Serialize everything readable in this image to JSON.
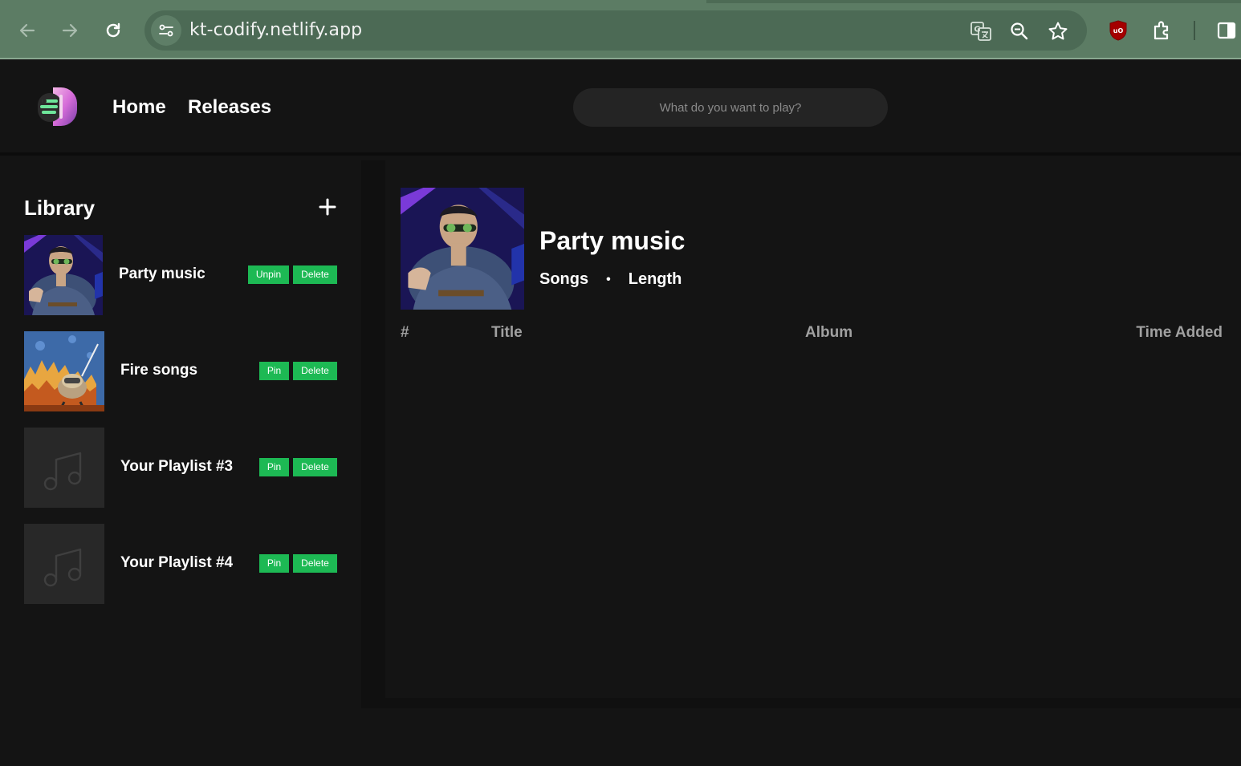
{
  "browser": {
    "url": "kt-codify.netlify.app",
    "icons": [
      "back-arrow-icon",
      "forward-arrow-icon",
      "reload-icon",
      "site-settings-icon",
      "translate-icon",
      "zoom-icon",
      "star-icon",
      "ublock-icon",
      "extensions-icon",
      "side-panel-icon"
    ]
  },
  "header": {
    "nav": [
      "Home",
      "Releases"
    ],
    "search_placeholder": "What do you want to play?"
  },
  "sidebar": {
    "title": "Library",
    "add_icon": "plus-icon",
    "playlists": [
      {
        "name": "Party music",
        "pin_label": "Unpin",
        "delete_label": "Delete",
        "cover": "party-photo"
      },
      {
        "name": "Fire songs",
        "pin_label": "Pin",
        "delete_label": "Delete",
        "cover": "fire-cartoon"
      },
      {
        "name": "Your Playlist #3",
        "pin_label": "Pin",
        "delete_label": "Delete",
        "cover": "music-note-icon"
      },
      {
        "name": "Your Playlist #4",
        "pin_label": "Pin",
        "delete_label": "Delete",
        "cover": "music-note-icon"
      }
    ]
  },
  "main": {
    "title": "Party music",
    "meta_songs": "Songs",
    "meta_dot": "•",
    "meta_length": "Length",
    "columns": [
      "#",
      "Title",
      "Album",
      "Time Added"
    ]
  },
  "colors": {
    "accent": "#1db954",
    "background": "#141414",
    "chrome": "#5c7c64"
  }
}
